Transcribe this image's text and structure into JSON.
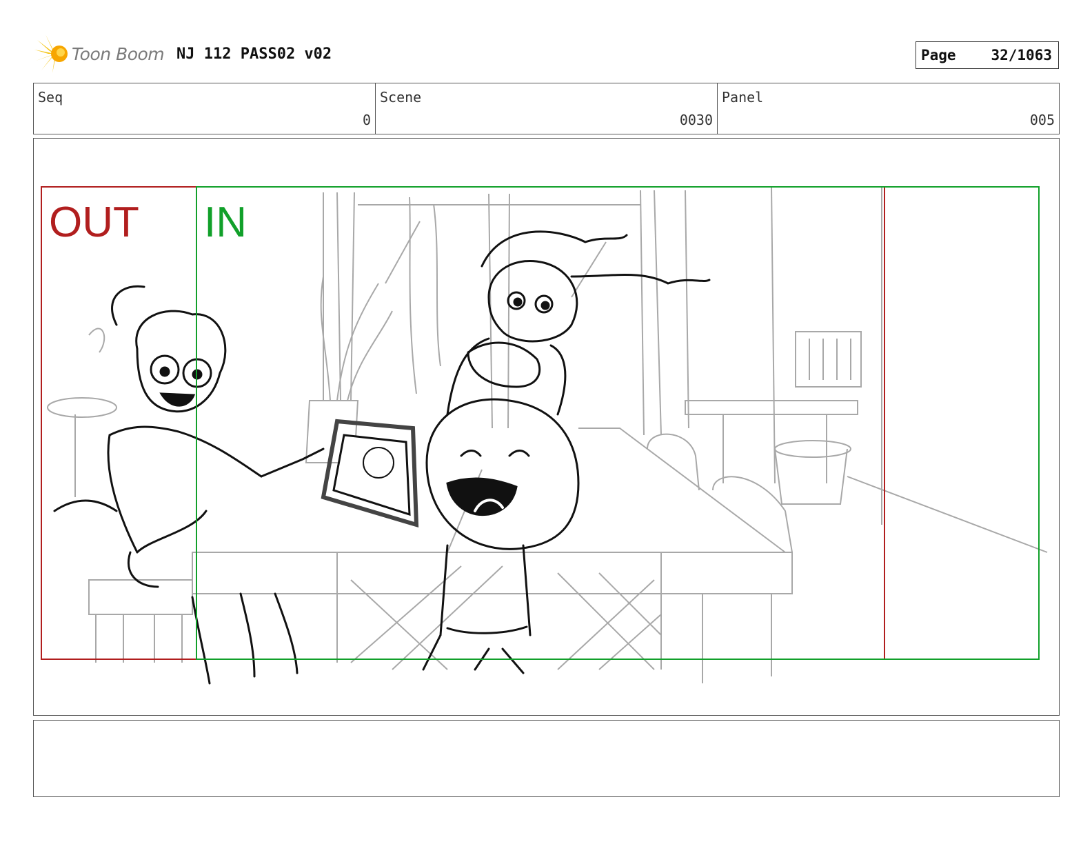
{
  "header": {
    "logo_text": "Toon Boom",
    "doc_title": "NJ 112 PASS02 v02",
    "page_label": "Page",
    "page_number": "32/1063"
  },
  "info": {
    "seq": {
      "label": "Seq",
      "value": "0"
    },
    "scene": {
      "label": "Scene",
      "value": "0030"
    },
    "panel": {
      "label": "Panel",
      "value": "005"
    }
  },
  "panel": {
    "out_label": "OUT",
    "in_label": "IN",
    "out_color": "#b11e1e",
    "in_color": "#11a02a"
  },
  "notes": {
    "text": ""
  }
}
